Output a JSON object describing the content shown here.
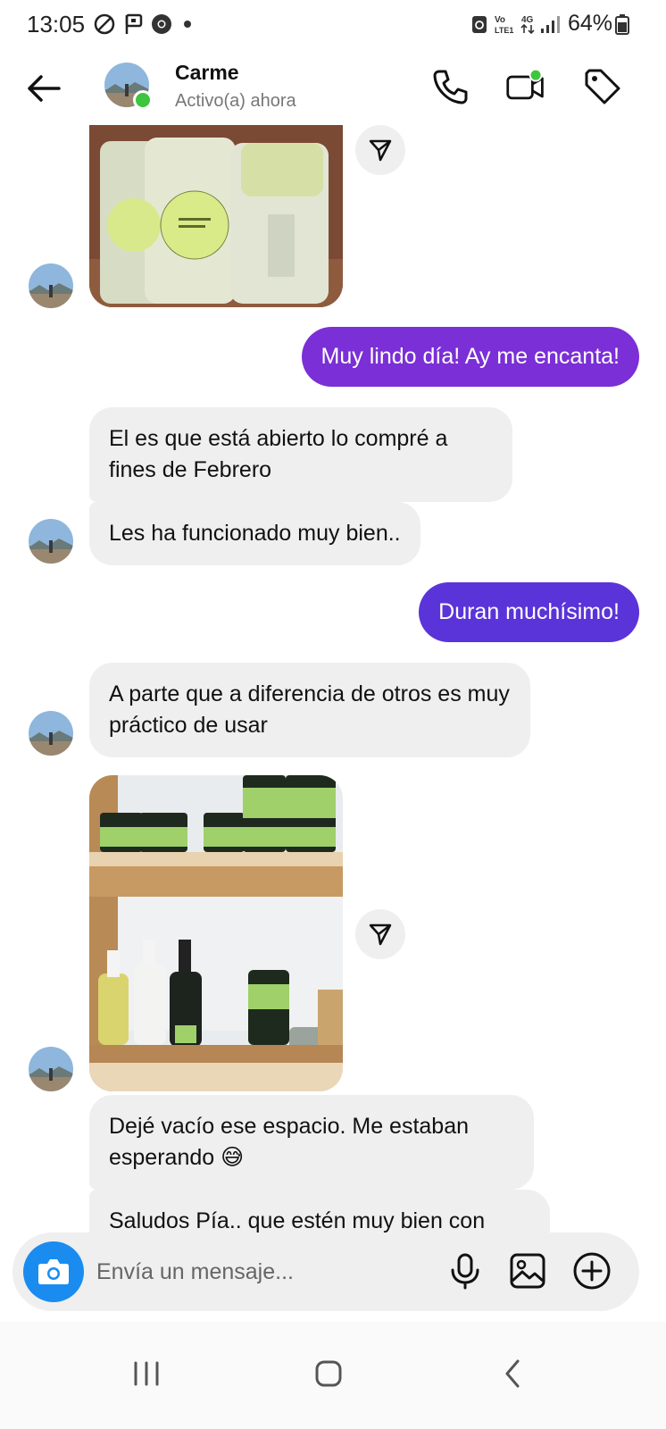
{
  "status_bar": {
    "time": "13:05",
    "battery": "64%",
    "network_icons": [
      "do-not-disturb-icon",
      "flag-notification-icon",
      "chrome-icon",
      "dot-icon",
      "recycle-icon",
      "volte-icon",
      "4g-icon",
      "signal-icon",
      "battery-icon"
    ]
  },
  "header": {
    "name": "Carme",
    "status": "Activo(a) ahora",
    "accent_online": "#3ec53e"
  },
  "messages": [
    {
      "type": "image",
      "from": "contact",
      "content": "lip balm sticks photo"
    },
    {
      "type": "text",
      "from": "me",
      "text": "Muy lindo día! Ay me encanta!",
      "color": "#7b2fd6"
    },
    {
      "type": "text",
      "from": "contact",
      "text": "El es que está abierto lo compré a fines de Febrero"
    },
    {
      "type": "text",
      "from": "contact",
      "text": "Les ha funcionado muy bien.."
    },
    {
      "type": "text",
      "from": "me",
      "text": "Duran muchísimo!",
      "color": "#5a34d8"
    },
    {
      "type": "text",
      "from": "contact",
      "text": "A parte que a diferencia de otros es muy práctico de usar"
    },
    {
      "type": "image",
      "from": "contact",
      "content": "shelf with cosmetic jars photo"
    },
    {
      "type": "text",
      "from": "contact",
      "text": "Dejé vacío ese espacio. Me estaban esperando 😅"
    },
    {
      "type": "text",
      "from": "contact",
      "text": "Saludos Pía.. que estén muy bien con"
    }
  ],
  "composer": {
    "placeholder": "Envía un mensaje..."
  },
  "colors": {
    "incoming_bubble": "#efefef",
    "camera_button": "#1a8cf0"
  }
}
